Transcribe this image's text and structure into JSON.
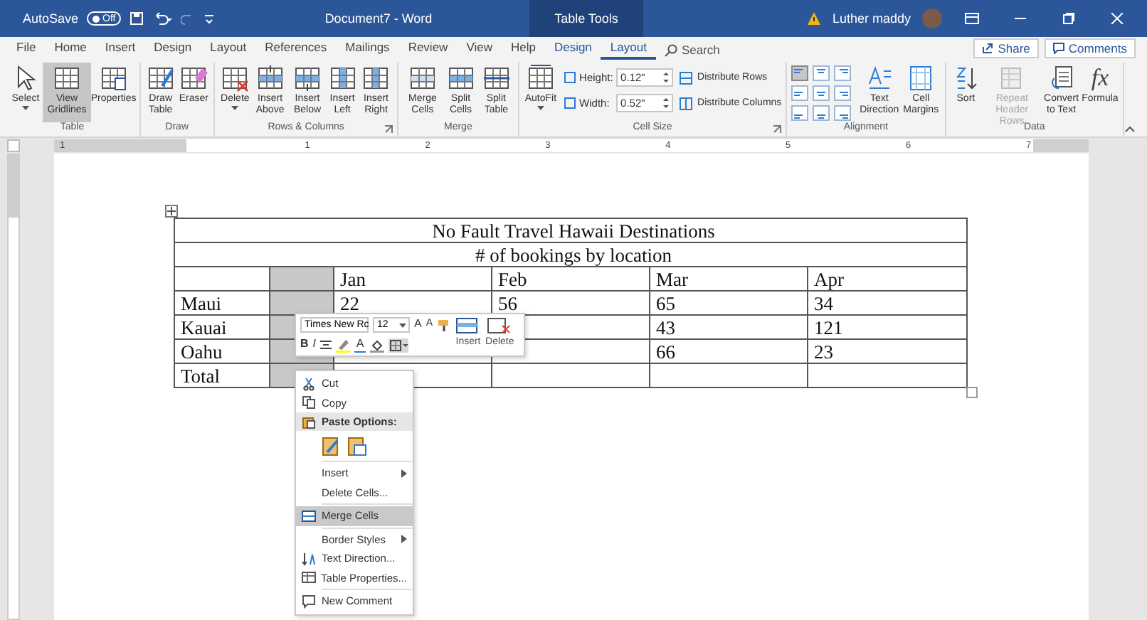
{
  "title_bar": {
    "autosave_label": "AutoSave",
    "autosave_toggle": {
      "label": "Off",
      "on": false
    },
    "document_title": "Document7 - Word",
    "context_label": "Table Tools",
    "user_name": "Luther maddy"
  },
  "tabs": [
    {
      "label": "File",
      "selected": false,
      "contextual": false
    },
    {
      "label": "Home",
      "selected": false,
      "contextual": false
    },
    {
      "label": "Insert",
      "selected": false,
      "contextual": false
    },
    {
      "label": "Design",
      "selected": false,
      "contextual": false
    },
    {
      "label": "Layout",
      "selected": false,
      "contextual": false
    },
    {
      "label": "References",
      "selected": false,
      "contextual": false
    },
    {
      "label": "Mailings",
      "selected": false,
      "contextual": false
    },
    {
      "label": "Review",
      "selected": false,
      "contextual": false
    },
    {
      "label": "View",
      "selected": false,
      "contextual": false
    },
    {
      "label": "Help",
      "selected": false,
      "contextual": false
    },
    {
      "label": "Design",
      "selected": false,
      "contextual": true
    },
    {
      "label": "Layout",
      "selected": true,
      "contextual": true
    }
  ],
  "search": {
    "label": "Search"
  },
  "share_button": "Share",
  "comments_button": "Comments",
  "ribbon": {
    "groups": [
      {
        "kind": "buttons",
        "label": "Table",
        "launcher": false,
        "items": [
          {
            "label": "Select",
            "dropdown": true,
            "selected": false,
            "disabled": false
          },
          {
            "label": "View Gridlines",
            "dropdown": false,
            "selected": true,
            "disabled": false
          },
          {
            "label": "Properties",
            "dropdown": false,
            "selected": false,
            "disabled": false
          }
        ]
      },
      {
        "kind": "buttons",
        "label": "Draw",
        "launcher": false,
        "items": [
          {
            "label": "Draw Table",
            "dropdown": false,
            "selected": false,
            "disabled": false
          },
          {
            "label": "Eraser",
            "dropdown": false,
            "selected": false,
            "disabled": false
          }
        ]
      },
      {
        "kind": "buttons",
        "label": "Rows & Columns",
        "launcher": true,
        "items": [
          {
            "label": "Delete",
            "dropdown": true,
            "selected": false,
            "disabled": false
          },
          {
            "label": "Insert Above",
            "dropdown": false,
            "selected": false,
            "disabled": false
          },
          {
            "label": "Insert Below",
            "dropdown": false,
            "selected": false,
            "disabled": false
          },
          {
            "label": "Insert Left",
            "dropdown": false,
            "selected": false,
            "disabled": false
          },
          {
            "label": "Insert Right",
            "dropdown": false,
            "selected": false,
            "disabled": false
          }
        ]
      },
      {
        "kind": "buttons",
        "label": "Merge",
        "launcher": false,
        "items": [
          {
            "label": "Merge Cells",
            "dropdown": false,
            "selected": false,
            "disabled": false
          },
          {
            "label": "Split Cells",
            "dropdown": false,
            "selected": false,
            "disabled": false
          },
          {
            "label": "Split Table",
            "dropdown": false,
            "selected": false,
            "disabled": false
          }
        ]
      },
      {
        "kind": "cell_size",
        "label": "Cell Size",
        "launcher": true,
        "items": [
          {
            "label": "AutoFit",
            "dropdown": true,
            "selected": false,
            "disabled": false
          }
        ],
        "fields": [
          {
            "label": "Height:",
            "value": "0.12\""
          },
          {
            "label": "Width:",
            "value": "0.52\""
          }
        ],
        "actions": [
          "Distribute Rows",
          "Distribute Columns"
        ]
      },
      {
        "kind": "alignment",
        "label": "Alignment",
        "launcher": false,
        "align_buttons": [
          {
            "selected": true
          },
          {
            "selected": false
          },
          {
            "selected": false
          },
          {
            "selected": false
          },
          {
            "selected": false
          },
          {
            "selected": false
          },
          {
            "selected": false
          },
          {
            "selected": false
          },
          {
            "selected": false
          }
        ],
        "items": [
          {
            "label": "Text Direction",
            "dropdown": false,
            "selected": false,
            "disabled": false
          },
          {
            "label": "Cell Margins",
            "dropdown": false,
            "selected": false,
            "disabled": false
          }
        ]
      },
      {
        "kind": "buttons",
        "label": "Data",
        "launcher": false,
        "items": [
          {
            "label": "Sort",
            "dropdown": false,
            "selected": false,
            "disabled": false
          },
          {
            "label": "Repeat Header Rows",
            "dropdown": false,
            "selected": false,
            "disabled": true
          },
          {
            "label": "Convert to Text",
            "dropdown": false,
            "selected": false,
            "disabled": false
          },
          {
            "label": "Formula",
            "glyph": "fx",
            "dropdown": false,
            "selected": false,
            "disabled": false
          }
        ]
      }
    ]
  },
  "ruler": {
    "labels": [
      "1",
      "1",
      "2",
      "3",
      "4",
      "5",
      "6",
      "7"
    ]
  },
  "table": {
    "title": "No Fault Travel Hawaii Destinations",
    "subtitle": "# of bookings by location",
    "rows": [
      {
        "cells": [
          {
            "selected": false
          },
          {
            "selected": true
          },
          {
            "text": "Jan",
            "selected": false
          },
          {
            "text": "Feb",
            "selected": false
          },
          {
            "text": "Mar",
            "selected": false
          },
          {
            "text": "Apr",
            "selected": false
          }
        ]
      },
      {
        "cells": [
          {
            "text": "Maui",
            "selected": false
          },
          {
            "selected": true
          },
          {
            "text": "22",
            "selected": false
          },
          {
            "text": "56",
            "selected": false
          },
          {
            "text": "65",
            "selected": false
          },
          {
            "text": "34",
            "selected": false
          }
        ]
      },
      {
        "cells": [
          {
            "text": "Kauai",
            "selected": false
          },
          {
            "selected": true
          },
          {},
          {},
          {
            "text": "43",
            "selected": false
          },
          {
            "text": "121",
            "selected": false
          }
        ]
      },
      {
        "cells": [
          {
            "text": "Oahu",
            "selected": false
          },
          {
            "selected": true
          },
          {},
          {},
          {
            "text": "66",
            "selected": false
          },
          {
            "text": "23",
            "selected": false
          }
        ]
      },
      {
        "cells": [
          {
            "text": "Total",
            "selected": false
          },
          {
            "selected": true
          },
          {
            "selected": false
          },
          {
            "selected": false
          },
          {
            "selected": false
          },
          {
            "selected": false
          }
        ]
      }
    ]
  },
  "mini_toolbar": {
    "font_field": "Times New Rc",
    "size_field": "12",
    "grow_glyph": "A",
    "shrink_glyph": "A",
    "bold_glyph": "B",
    "italic_glyph": "I",
    "font_color_glyph": "A",
    "insert_label": "Insert",
    "delete_label": "Delete"
  },
  "context_menu": {
    "items": [
      {
        "kind": "item",
        "label": "Cut",
        "submenu": false,
        "selected": false
      },
      {
        "kind": "item",
        "label": "Copy",
        "submenu": false,
        "selected": false
      },
      {
        "kind": "header",
        "label": "Paste Options:"
      },
      {
        "kind": "paste"
      },
      {
        "kind": "separator"
      },
      {
        "kind": "item",
        "label": "Insert",
        "submenu": true,
        "selected": false
      },
      {
        "kind": "item",
        "label": "Delete Cells...",
        "submenu": false,
        "selected": false
      },
      {
        "kind": "separator"
      },
      {
        "kind": "item",
        "label": "Merge Cells",
        "submenu": false,
        "selected": true
      },
      {
        "kind": "separator"
      },
      {
        "kind": "item",
        "label": "Border Styles",
        "submenu": true,
        "selected": false
      },
      {
        "kind": "item",
        "label": "Text Direction...",
        "submenu": false,
        "selected": false
      },
      {
        "kind": "item",
        "label": "Table Properties...",
        "submenu": false,
        "selected": false
      },
      {
        "kind": "separator"
      },
      {
        "kind": "item",
        "label": "New Comment",
        "submenu": false,
        "selected": false
      }
    ]
  }
}
